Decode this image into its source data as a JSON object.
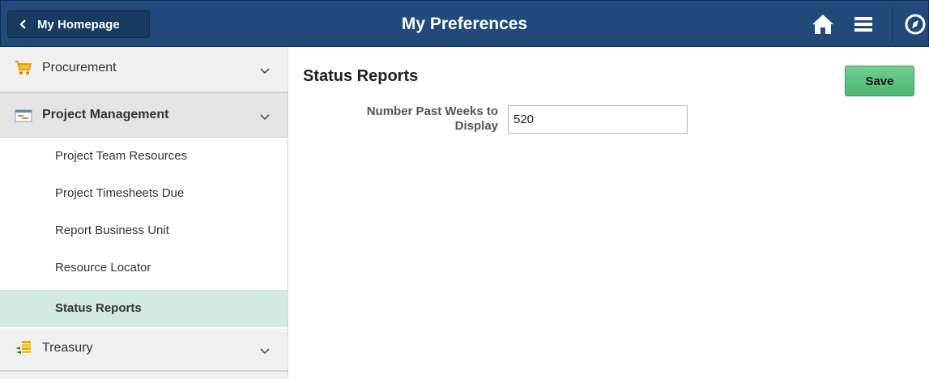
{
  "header": {
    "back_label": "My Homepage",
    "title": "My Preferences",
    "icons": [
      "home-icon",
      "menu-icon",
      "navigator-icon"
    ]
  },
  "sidebar": {
    "sections": [
      {
        "label": "Procurement",
        "icon": "cart-icon",
        "expanded": false
      },
      {
        "label": "Project Management",
        "icon": "project-icon",
        "expanded": true,
        "items": [
          {
            "label": "Project Team Resources",
            "active": false
          },
          {
            "label": "Project Timesheets Due",
            "active": false
          },
          {
            "label": "Report Business Unit",
            "active": false
          },
          {
            "label": "Resource Locator",
            "active": false
          },
          {
            "label": "Status Reports",
            "active": true
          }
        ]
      },
      {
        "label": "Treasury",
        "icon": "treasury-icon",
        "expanded": false
      }
    ]
  },
  "main": {
    "title": "Status Reports",
    "save_label": "Save",
    "field": {
      "label": "Number Past Weeks to Display",
      "value": "520"
    }
  },
  "colors": {
    "header_bg": "#1f4a79",
    "active_item_bg": "#d2ebdc",
    "save_button": "#5cc17f"
  }
}
